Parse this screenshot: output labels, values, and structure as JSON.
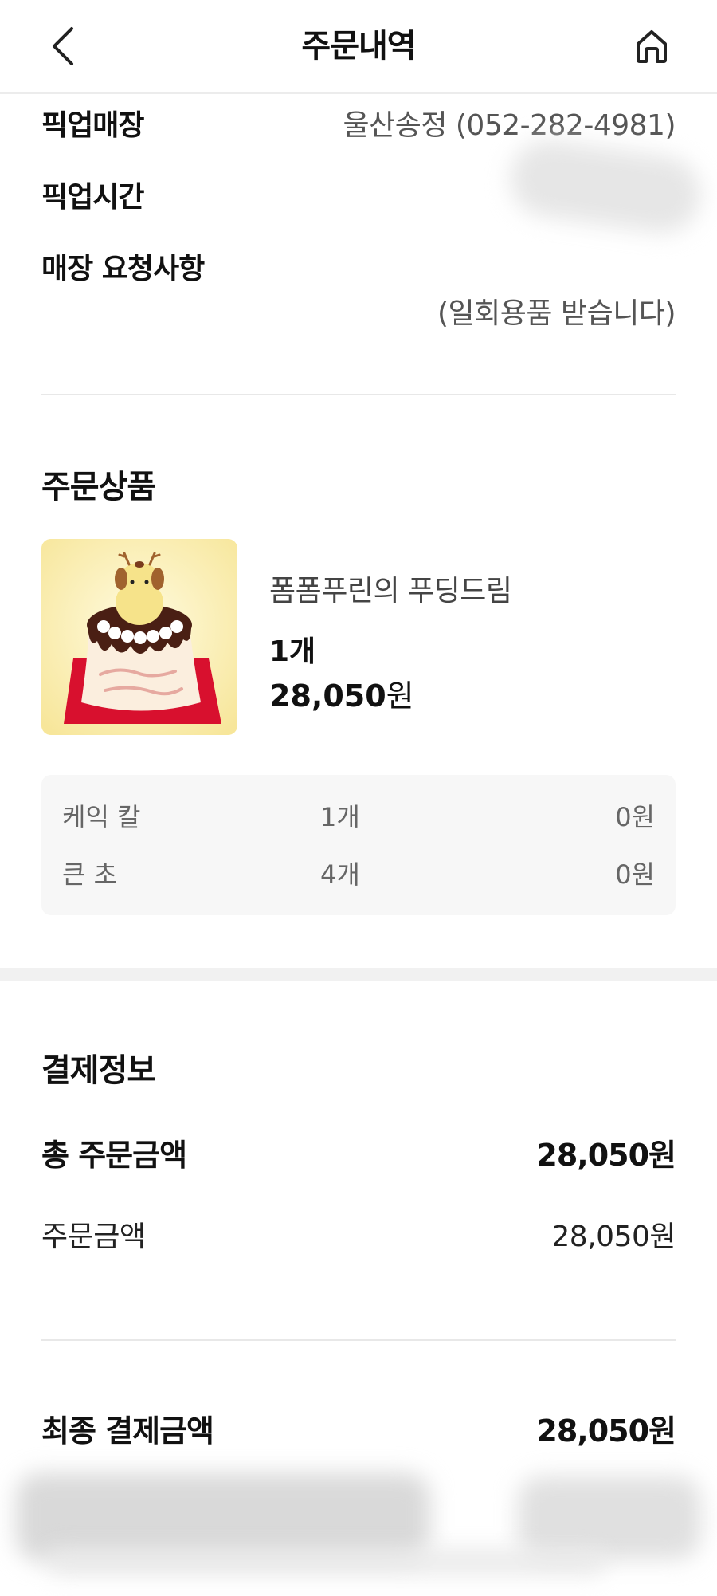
{
  "header": {
    "title": "주문내역",
    "back_icon": "chevron-left-icon",
    "home_icon": "home-icon"
  },
  "pickup": {
    "store_label": "픽업매장",
    "store_value": "울산송정 (052-282-4981)",
    "time_label": "픽업시간",
    "request_label": "매장 요청사항",
    "request_value": "(일회용품 받습니다)"
  },
  "order_items": {
    "section_title": "주문상품",
    "product": {
      "name": "폼폼푸린의 푸딩드림",
      "quantity": "1개",
      "price_number": "28,050",
      "price_unit": "원"
    },
    "options": [
      {
        "name": "케익 칼",
        "qty": "1개",
        "price": "0원"
      },
      {
        "name": "큰 초",
        "qty": "4개",
        "price": "0원"
      }
    ]
  },
  "payment": {
    "section_title": "결제정보",
    "total_label": "총 주문금액",
    "total_value": "28,050원",
    "order_amount_label": "주문금액",
    "order_amount_value": "28,050원",
    "final_label": "최종 결제금액",
    "final_value": "28,050원"
  },
  "colors": {
    "text_primary": "#111111",
    "text_secondary": "#555555",
    "divider": "#e8e8e8",
    "option_bg": "#f7f7f7"
  }
}
